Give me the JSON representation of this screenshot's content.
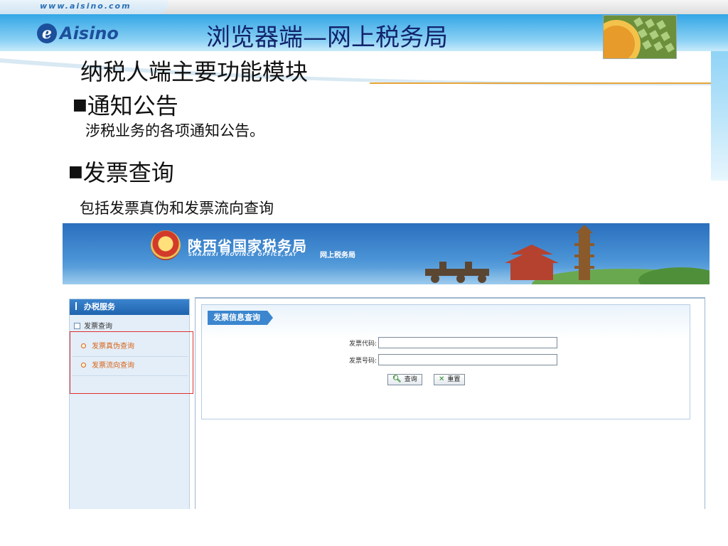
{
  "slide": {
    "site_url": "www.aisino.com",
    "logo_text": "Aisino",
    "title": "浏览器端—网上税务局",
    "subtitle": "纳税人端主要功能模块",
    "bullets": [
      {
        "mark": "■",
        "heading": "通知公告",
        "text": "涉税业务的各项通知公告。"
      },
      {
        "mark": "■",
        "heading": "发票查询",
        "text": "包括发票真伪和发票流向查询"
      }
    ]
  },
  "app": {
    "bureau_name": "陕西省国家税务局",
    "bureau_en": "SHAANXI PROVINCE OFFICE,SAT",
    "bureau_sub": "网上税务局",
    "sidebar": {
      "header": "办税服务",
      "group": "发票查询",
      "items": [
        {
          "label": "发票真伪查询"
        },
        {
          "label": "发票流向查询"
        }
      ]
    },
    "panel": {
      "title": "发票信息查询",
      "fields": [
        {
          "label": "发票代码:",
          "value": ""
        },
        {
          "label": "发票号码:",
          "value": ""
        }
      ],
      "buttons": {
        "query": "查询",
        "reset": "重置"
      }
    }
  }
}
